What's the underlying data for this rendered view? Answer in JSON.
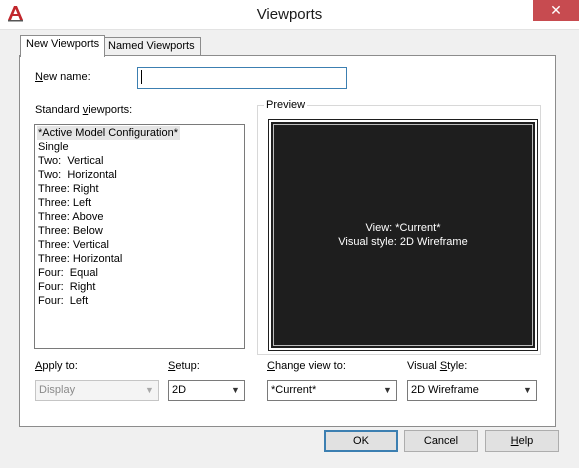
{
  "window": {
    "title": "Viewports",
    "close_glyph": "✕",
    "app_icon": "autocad-a-icon"
  },
  "tabs": [
    {
      "label": "New Viewports",
      "active": true
    },
    {
      "label": "Named Viewports",
      "active": false
    }
  ],
  "new_name": {
    "label_pre": "",
    "label_access": "N",
    "label_post": "ew name:",
    "value": ""
  },
  "standard_viewports": {
    "label_pre": "Standard ",
    "label_access": "v",
    "label_post": "iewports:",
    "items": [
      "*Active Model Configuration*",
      "Single",
      "Two:  Vertical",
      "Two:  Horizontal",
      "Three: Right",
      "Three: Left",
      "Three: Above",
      "Three: Below",
      "Three: Vertical",
      "Three: Horizontal",
      "Four:  Equal",
      "Four:  Right",
      "Four:  Left"
    ],
    "selected_index": 0
  },
  "preview": {
    "label": "Preview",
    "view_line": "View: *Current*",
    "style_line": "Visual style: 2D Wireframe",
    "background": "#1e1e1e"
  },
  "apply_to": {
    "label_pre": "",
    "label_access": "A",
    "label_post": "pply to:",
    "value": "Display",
    "enabled": false
  },
  "setup": {
    "label_pre": "",
    "label_access": "S",
    "label_post": "etup:",
    "value": "2D"
  },
  "change_view": {
    "label_pre": "",
    "label_access": "C",
    "label_post": "hange view to:",
    "value": "*Current*"
  },
  "visual_style": {
    "label_pre": "Visual ",
    "label_access": "S",
    "label_post": "tyle:",
    "value": "2D Wireframe"
  },
  "buttons": {
    "ok": "OK",
    "cancel": "Cancel",
    "help_access": "H",
    "help_rest": "elp"
  },
  "colors": {
    "close_button": "#c74b50",
    "focus_border": "#3c7fb1"
  }
}
